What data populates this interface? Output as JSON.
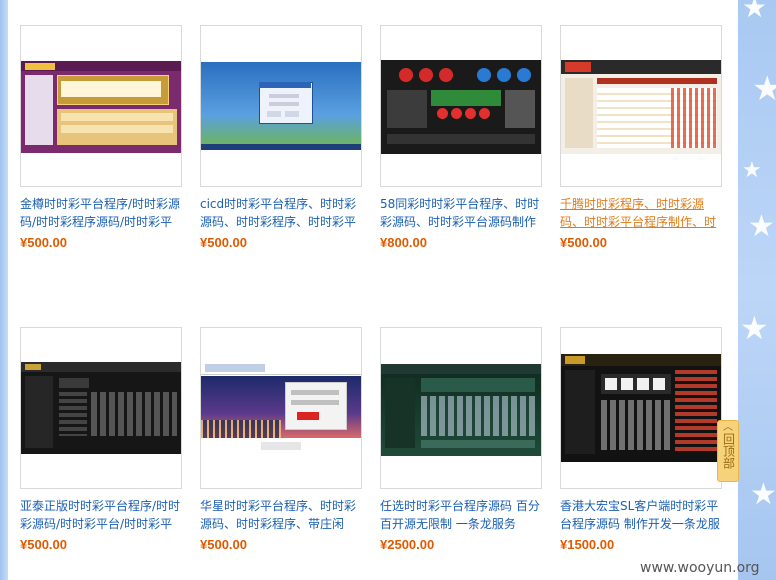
{
  "products": [
    {
      "title": "金樽时时彩平台程序/时时彩源码/时时彩程序源码/时时彩平台",
      "price": "¥500.00"
    },
    {
      "title": "cicd时时彩平台程序、时时彩源码、时时彩程序、时时彩平",
      "price": "¥500.00"
    },
    {
      "title": "58同彩时时彩平台程序、时时彩源码、时时彩平台源码制作",
      "price": "¥800.00"
    },
    {
      "title": "千腾时时彩程序、时时彩源码、时时彩平台程序制作、时",
      "price": "¥500.00"
    },
    {
      "title": "亚泰正版时时彩平台程序/时时彩源码/时时彩平台/时时彩平台",
      "price": "¥500.00"
    },
    {
      "title": "华星时时彩平台程序、时时彩源码、时时彩程序、带庄闲",
      "price": "¥500.00"
    },
    {
      "title": "任选时时彩平台程序源码 百分百开源无限制 一条龙服务",
      "price": "¥2500.00"
    },
    {
      "title": "香港大宏宝SL客户端时时彩平台程序源码 制作开发一条龙服",
      "price": "¥1500.00"
    }
  ],
  "back_to_top": "回顶部",
  "watermark": "www.wooyun.org",
  "colors": {
    "title_link": "#1a5fb4",
    "title_hover": "#e07b1a",
    "price": "#e05a00",
    "side_bg": "#a9c9f2"
  }
}
